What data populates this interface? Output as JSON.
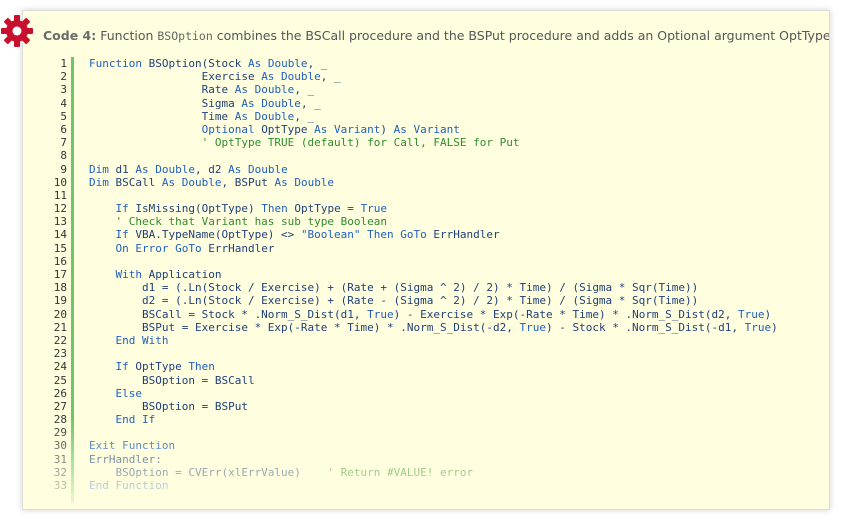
{
  "caption": {
    "label": "Code 4:",
    "text_before": " Function ",
    "mono": "BSOption",
    "text_after": " combines the BSCall procedure and the BSPut procedure and adds an Optional argument OptType"
  },
  "colors": {
    "background": "#ffffe0",
    "gutter_bar": "#6cc76c",
    "keyword": "#1f5fbf",
    "comment": "#2e8b2e",
    "gear": "#c8102e"
  },
  "icon": "gear-icon",
  "code_lines": [
    {
      "n": "1",
      "segs": [
        [
          "kw",
          "Function "
        ],
        [
          "",
          "BSOption(Stock "
        ],
        [
          "kw",
          "As Double"
        ],
        [
          "",
          ", _"
        ]
      ]
    },
    {
      "n": "2",
      "segs": [
        [
          "",
          "                 Exercise "
        ],
        [
          "kw",
          "As Double"
        ],
        [
          "",
          ", _"
        ]
      ]
    },
    {
      "n": "3",
      "segs": [
        [
          "",
          "                 Rate "
        ],
        [
          "kw",
          "As Double"
        ],
        [
          "",
          ", _"
        ]
      ]
    },
    {
      "n": "4",
      "segs": [
        [
          "",
          "                 Sigma "
        ],
        [
          "kw",
          "As Double"
        ],
        [
          "",
          ", _"
        ]
      ]
    },
    {
      "n": "5",
      "segs": [
        [
          "",
          "                 Time "
        ],
        [
          "kw",
          "As Double"
        ],
        [
          "",
          ", _"
        ]
      ]
    },
    {
      "n": "6",
      "segs": [
        [
          "kw",
          "                 Optional "
        ],
        [
          "",
          "OptType "
        ],
        [
          "kw",
          "As Variant"
        ],
        [
          "",
          ") "
        ],
        [
          "kw",
          "As Variant"
        ]
      ]
    },
    {
      "n": "7",
      "segs": [
        [
          "cm",
          "                 ' OptType TRUE (default) for Call, FALSE for Put"
        ]
      ]
    },
    {
      "n": "8",
      "segs": []
    },
    {
      "n": "9",
      "segs": [
        [
          "kw",
          "Dim "
        ],
        [
          "",
          "d1 "
        ],
        [
          "kw",
          "As Double"
        ],
        [
          "",
          ", d2 "
        ],
        [
          "kw",
          "As Double"
        ]
      ]
    },
    {
      "n": "10",
      "segs": [
        [
          "kw",
          "Dim "
        ],
        [
          "",
          "BSCall "
        ],
        [
          "kw",
          "As Double"
        ],
        [
          "",
          ", BSPut "
        ],
        [
          "kw",
          "As Double"
        ]
      ]
    },
    {
      "n": "11",
      "segs": []
    },
    {
      "n": "12",
      "segs": [
        [
          "kw",
          "    If "
        ],
        [
          "",
          "IsMissing(OptType) "
        ],
        [
          "kw",
          "Then "
        ],
        [
          "",
          "OptType = "
        ],
        [
          "kw",
          "True"
        ]
      ]
    },
    {
      "n": "13",
      "segs": [
        [
          "cm",
          "    ' Check that Variant has sub type Boolean"
        ]
      ]
    },
    {
      "n": "14",
      "segs": [
        [
          "kw",
          "    If "
        ],
        [
          "",
          "VBA.TypeName(OptType) <> "
        ],
        [
          "st",
          "\"Boolean\""
        ],
        [
          "kw",
          " Then GoTo "
        ],
        [
          "",
          "ErrHandler"
        ]
      ]
    },
    {
      "n": "15",
      "segs": [
        [
          "kw",
          "    On Error GoTo "
        ],
        [
          "",
          "ErrHandler"
        ]
      ]
    },
    {
      "n": "16",
      "segs": []
    },
    {
      "n": "17",
      "segs": [
        [
          "kw",
          "    With "
        ],
        [
          "",
          "Application"
        ]
      ]
    },
    {
      "n": "18",
      "segs": [
        [
          "",
          "        d1 = (.Ln(Stock / Exercise) + (Rate + (Sigma ^ 2) / 2) * Time) / (Sigma * Sqr(Time))"
        ]
      ]
    },
    {
      "n": "19",
      "segs": [
        [
          "",
          "        d2 = (.Ln(Stock / Exercise) + (Rate - (Sigma ^ 2) / 2) * Time) / (Sigma * Sqr(Time))"
        ]
      ]
    },
    {
      "n": "20",
      "segs": [
        [
          "",
          "        BSCall = Stock * .Norm_S_Dist(d1, "
        ],
        [
          "kw",
          "True"
        ],
        [
          "",
          ") - Exercise * Exp(-Rate * Time) * .Norm_S_Dist(d2, "
        ],
        [
          "kw",
          "True"
        ],
        [
          "",
          ")"
        ]
      ]
    },
    {
      "n": "21",
      "segs": [
        [
          "",
          "        BSPut = Exercise * Exp(-Rate * Time) * .Norm_S_Dist(-d2, "
        ],
        [
          "kw",
          "True"
        ],
        [
          "",
          ") - Stock * .Norm_S_Dist(-d1, "
        ],
        [
          "kw",
          "True"
        ],
        [
          "",
          ")"
        ]
      ]
    },
    {
      "n": "22",
      "segs": [
        [
          "kw",
          "    End With"
        ]
      ]
    },
    {
      "n": "23",
      "segs": []
    },
    {
      "n": "24",
      "segs": [
        [
          "kw",
          "    If "
        ],
        [
          "",
          "OptType "
        ],
        [
          "kw",
          "Then"
        ]
      ]
    },
    {
      "n": "25",
      "segs": [
        [
          "",
          "        BSOption = BSCall"
        ]
      ]
    },
    {
      "n": "26",
      "segs": [
        [
          "kw",
          "    Else"
        ]
      ]
    },
    {
      "n": "27",
      "segs": [
        [
          "",
          "        BSOption = BSPut"
        ]
      ]
    },
    {
      "n": "28",
      "segs": [
        [
          "kw",
          "    End If"
        ]
      ]
    },
    {
      "n": "29",
      "segs": []
    },
    {
      "n": "30",
      "segs": [
        [
          "kw",
          "Exit Function"
        ]
      ]
    },
    {
      "n": "31",
      "segs": [
        [
          "",
          "ErrHandler:"
        ]
      ]
    },
    {
      "n": "32",
      "segs": [
        [
          "",
          "    BSOption = CVErr(xlErrValue)    "
        ],
        [
          "cm",
          "' Return #VALUE! error"
        ]
      ]
    },
    {
      "n": "33",
      "segs": [
        [
          "kw",
          "End Function"
        ]
      ]
    }
  ]
}
